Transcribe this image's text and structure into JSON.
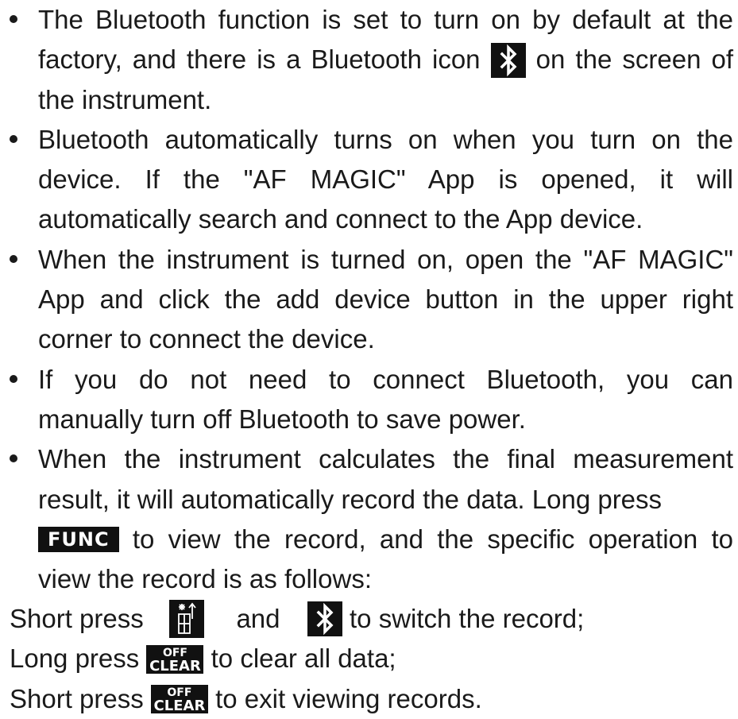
{
  "bullets": [
    {
      "l1": "The Bluetooth function is set to turn on by default at the",
      "l2a": "factory, and there is a Bluetooth icon",
      "l2b": "on the screen of",
      "l3": "the instrument."
    },
    {
      "l1": "Bluetooth automatically turns on when you turn on the",
      "l2": "device. If the \"AF MAGIC\" App is opened, it will",
      "l3": "automatically search and connect to the App device."
    },
    {
      "l1": "When the instrument is turned on, open the \"AF MAGIC\"",
      "l2": "App and click the add device button in the upper right",
      "l3": "corner to connect the device."
    },
    {
      "l1": "If you do not need to connect Bluetooth, you can",
      "l2": "manually turn off Bluetooth to save power."
    },
    {
      "l1": "When the instrument calculates the final measurement",
      "l2": "result, it will automatically record the data. Long press",
      "l3b": "to view the record, and the specific operation to",
      "l4": "view the record is as follows:"
    }
  ],
  "keys": {
    "func": "FUNC",
    "off": "OFF",
    "clear": "CLEAR"
  },
  "steps": {
    "s1a": "Short press",
    "s1b": "and",
    "s1c": "to switch the record;",
    "s2a": "Long press",
    "s2b": "to clear all data;",
    "s3a": "Short press",
    "s3b": "to exit viewing records."
  },
  "icons": {
    "bluetooth": "bluetooth-icon",
    "measure_mode": "measure-mode-icon"
  }
}
